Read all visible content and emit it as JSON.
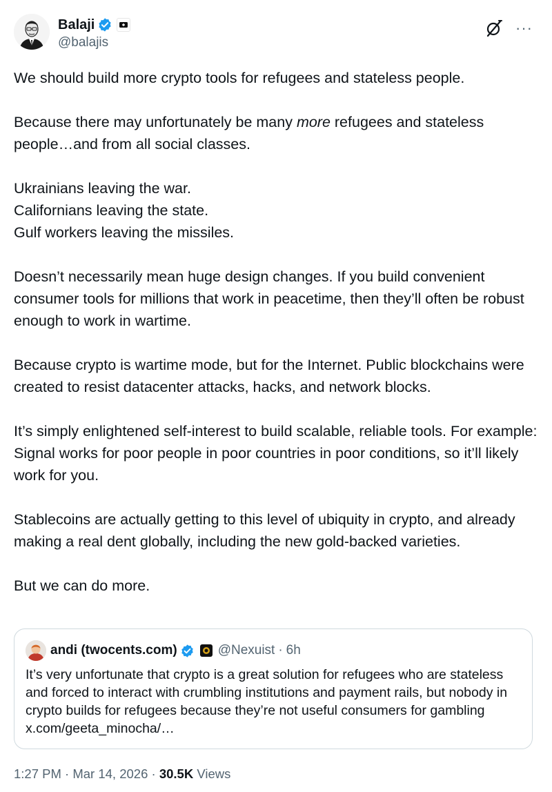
{
  "author": {
    "display_name": "Balaji",
    "handle": "@balajis",
    "verified_icon": "verified-badge-icon",
    "affiliation_icon": "affiliation-badge-icon"
  },
  "header_actions": {
    "grok_icon": "grok-icon",
    "more_label": "···"
  },
  "body": {
    "p1": "We should build more crypto tools for refugees and stateless people.",
    "p2_before": "Because there may unfortunately be many ",
    "p2_em": "more",
    "p2_after": " refugees and stateless people…and from all social classes.",
    "p3_l1": "Ukrainians leaving the war.",
    "p3_l2": "Californians leaving the state.",
    "p3_l3": "Gulf workers leaving the missiles.",
    "p4": "Doesn’t necessarily mean huge design changes. If you build convenient consumer tools for millions that work in peacetime, then they’ll often be robust enough to work in wartime.",
    "p5": "Because crypto is wartime mode, but for the Internet. Public blockchains were created to resist datacenter attacks, hacks, and network blocks.",
    "p6": "It’s simply enlightened self-interest to build scalable, reliable tools. For example: Signal works for poor people in poor countries in poor conditions, so it’ll likely work for you.",
    "p7": "Stablecoins are actually getting to this level of ubiquity in crypto, and already making a real dent globally, including the new gold-backed varieties.",
    "p8": "But we can do more."
  },
  "quote": {
    "display_name": "andi (twocents.com)",
    "handle": "@Nexuist",
    "dot": "·",
    "time": "6h",
    "text": "It’s very unfortunate that crypto is a great solution for refugees who are stateless and forced to interact with crumbling institutions and payment rails, but nobody in crypto builds for refugees because they’re not useful consumers for gambling x.com/geeta_minocha/…"
  },
  "footer": {
    "time": "1:27 PM",
    "sep1": " · ",
    "date": "Mar 14, 2026",
    "sep2": " · ",
    "views_count": "30.5K",
    "views_label": " Views"
  },
  "colors": {
    "text": "#0f1419",
    "secondary": "#536471",
    "verified_blue": "#1d9bf0",
    "border": "#cfd9de"
  }
}
